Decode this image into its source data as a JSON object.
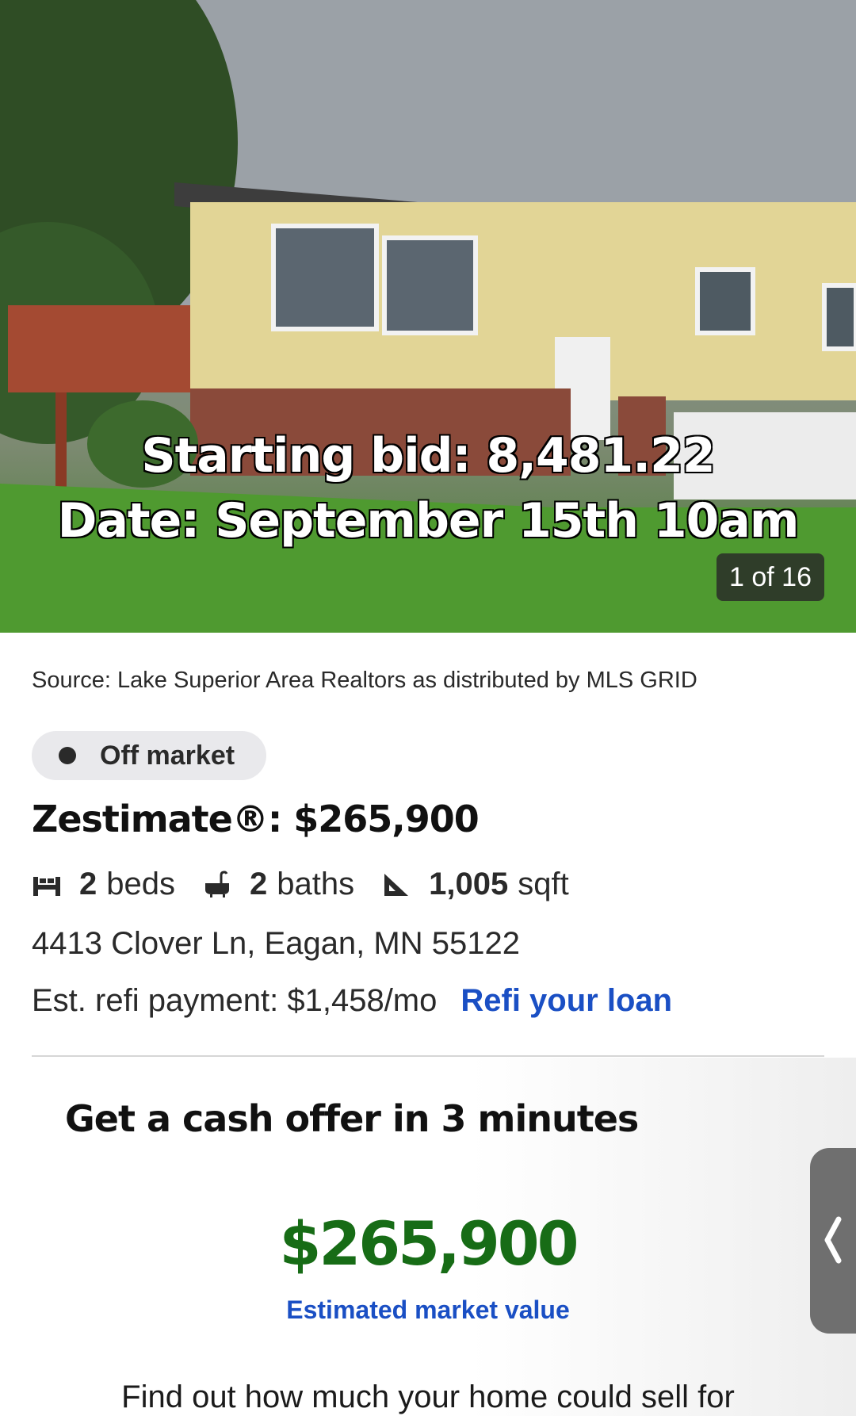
{
  "hero": {
    "overlay_line1": "Starting bid: 8,481.22",
    "overlay_line2": "Date: September 15th 10am",
    "photo_counter": "1 of 16"
  },
  "source_text": "Source: Lake Superior Area Realtors as distributed by MLS GRID",
  "status_badge": "Off market",
  "zestimate": "Zestimate®: $265,900",
  "facts": {
    "beds_num": "2",
    "beds_label": "beds",
    "baths_num": "2",
    "baths_label": "baths",
    "sqft_num": "1,005",
    "sqft_label": "sqft"
  },
  "address": "4413 Clover Ln, Eagan, MN 55122",
  "refi": {
    "payment": "Est. refi payment: $1,458/mo",
    "link": "Refi your loan"
  },
  "cash_offer": {
    "title": "Get a cash offer in 3 minutes",
    "value": "$265,900",
    "value_label": "Estimated market value",
    "footer": "Find out how much your home could sell for"
  },
  "icons": [
    "bed-icon",
    "bath-icon",
    "ruler-icon",
    "chevron-left-icon"
  ],
  "colors": {
    "link": "#1a4fc4",
    "value_green": "#176c16"
  }
}
